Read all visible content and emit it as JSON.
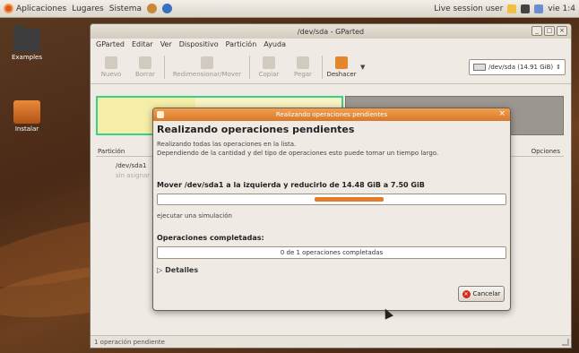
{
  "panel": {
    "menus": [
      "Aplicaciones",
      "Lugares",
      "Sistema"
    ],
    "user_text": "Live session user",
    "clock": "vie 1:4"
  },
  "desktop_icons": [
    {
      "label": "Examples"
    },
    {
      "label": "Instalar"
    }
  ],
  "window": {
    "title": "/dev/sda - GParted",
    "menu": [
      "GParted",
      "Editar",
      "Ver",
      "Dispositivo",
      "Partición",
      "Ayuda"
    ],
    "toolbar": {
      "buttons": [
        "Nuevo",
        "Borrar",
        "Redimensionar/Mover",
        "Copiar",
        "Pegar"
      ],
      "undo": "Deshacer",
      "device": "/dev/sda  (14.91 GiB)"
    },
    "table": {
      "col_partition": "Partición",
      "col_flags": "Opciones",
      "rows": [
        "/dev/sda1",
        "sin asignar"
      ]
    },
    "status": "1 operación pendiente"
  },
  "dialog": {
    "title": "Realizando operaciones pendientes",
    "heading": "Realizando operaciones pendientes",
    "description": "Realizando todas las operaciones en la lista.\nDependiendo de la cantidad y del tipo de operaciones esto puede tomar un tiempo largo.",
    "current_operation": "Mover /dev/sda1 a la izquierda y reducirlo de 14.48 GiB a 7.50 GiB",
    "progress_fraction": 0.2,
    "substep": "ejecutar una simulación",
    "completed_heading": "Operaciones completadas:",
    "completed_text": "0 de 1 operaciones completadas",
    "details_label": "Detalles",
    "cancel_label": "Cancelar"
  },
  "colors": {
    "accent": "#e57a28",
    "selected_partition_border": "#39d08a"
  }
}
